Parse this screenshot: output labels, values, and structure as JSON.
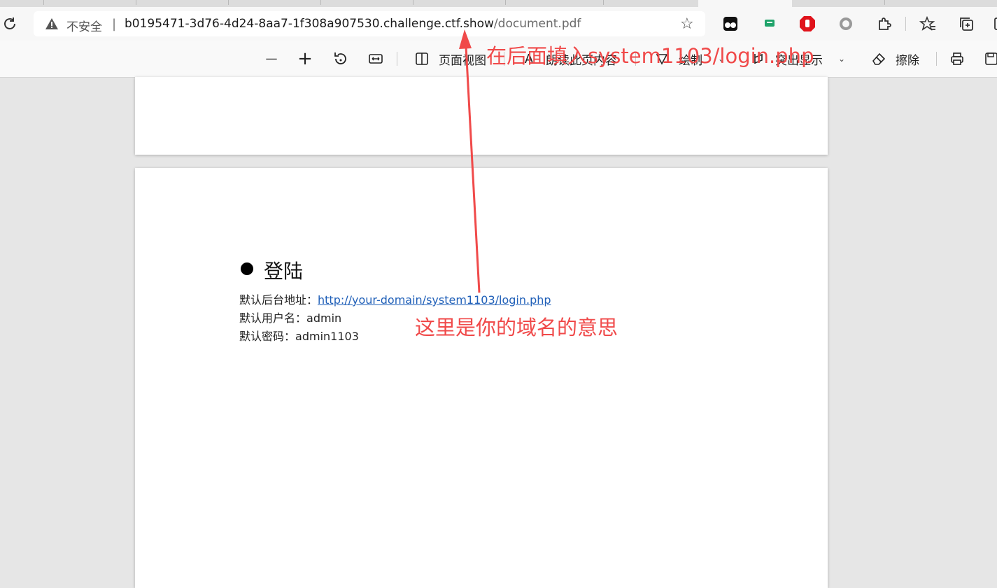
{
  "browser": {
    "security_label": "不安全",
    "separator": "|",
    "url_host": "b0195471-3d76-4d24-8aa7-1f308a907530.challenge.ctf.show",
    "url_path": "/document.pdf",
    "icons": [
      "refresh-icon",
      "warning-icon",
      "favorite-star-icon",
      "tampermonkey-icon",
      "chat-extension-icon",
      "adblock-icon",
      "circle-extension-icon",
      "extensions-puzzle-icon",
      "favorites-icon",
      "collections-icon"
    ]
  },
  "pdf_toolbar": {
    "zoom_out": "—",
    "zoom_in": "+",
    "page_view": "页面视图",
    "read_aloud": "朗读此页内容",
    "draw": "绘制",
    "highlight": "突出显示",
    "erase": "擦除"
  },
  "document": {
    "heading": "登陆",
    "admin_url_label": "默认后台地址：",
    "admin_url": "http://your-domain/system1103/login.php",
    "username_label": "默认用户名：",
    "username": "admin",
    "password_label": "默认密码：",
    "password": "admin1103"
  },
  "annotations": {
    "top_note": "在后面填入system1103/login.php",
    "middle_note": "这里是你的域名的意思",
    "color": "#f04a4a"
  }
}
